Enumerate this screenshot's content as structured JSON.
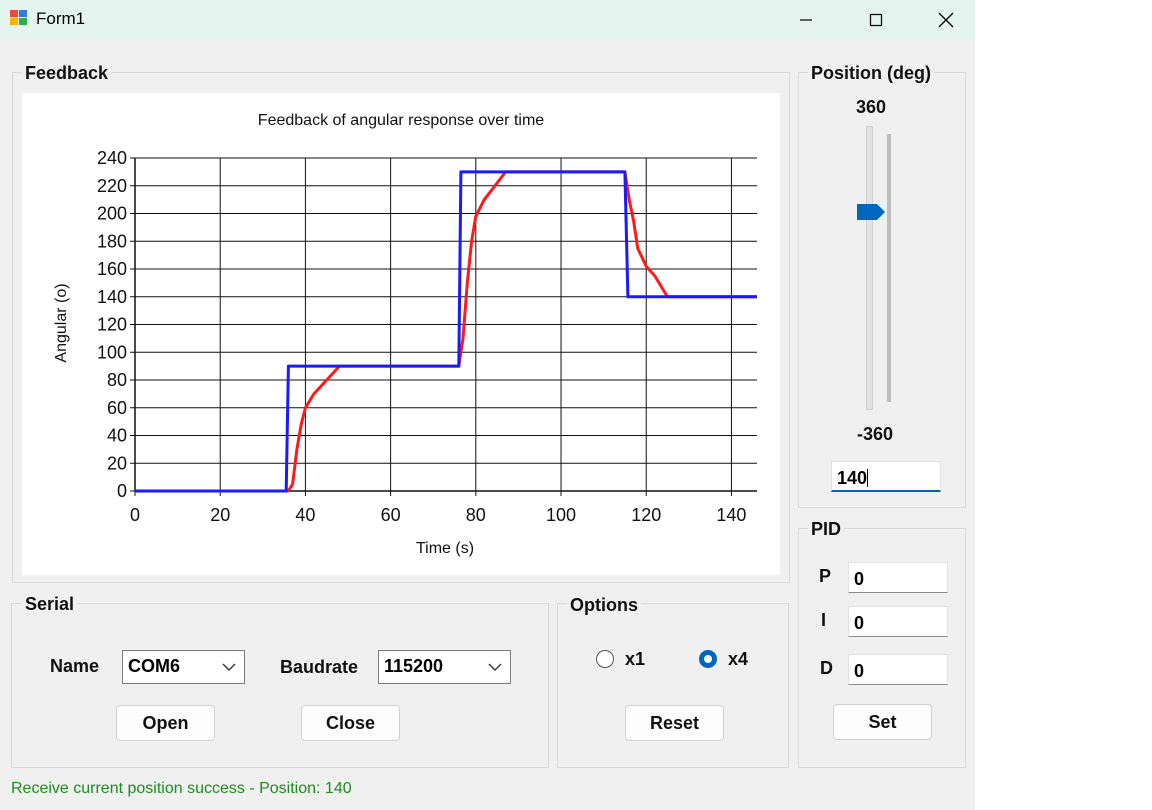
{
  "window": {
    "title": "Form1"
  },
  "feedback": {
    "title": "Feedback"
  },
  "chart_data": {
    "type": "line",
    "title": "Feedback of angular response over time",
    "xlabel": "Time (s)",
    "ylabel": "Angular (o)",
    "xlim": [
      0,
      146
    ],
    "ylim": [
      0,
      240
    ],
    "xticks": [
      0,
      20,
      40,
      60,
      80,
      100,
      120,
      140
    ],
    "yticks": [
      0,
      20,
      40,
      60,
      80,
      100,
      120,
      140,
      160,
      180,
      200,
      220,
      240
    ],
    "grid": true,
    "series": [
      {
        "color": "#1a1aff",
        "x": [
          0,
          35.5,
          36,
          76,
          76.5,
          115,
          115.7,
          146
        ],
        "y": [
          0,
          0,
          90,
          90,
          230,
          230,
          140,
          140
        ]
      },
      {
        "color": "#ff1a1a",
        "x": [
          0,
          36,
          37,
          38,
          39,
          40,
          42,
          45,
          48,
          76,
          77,
          78,
          79,
          80,
          82,
          84,
          87,
          115,
          116,
          117,
          118,
          120,
          122,
          125,
          146
        ],
        "y": [
          0,
          0,
          5,
          30,
          48,
          60,
          70,
          80,
          90,
          90,
          110,
          150,
          180,
          198,
          210,
          218,
          230,
          230,
          210,
          195,
          175,
          162,
          155,
          140,
          140
        ]
      }
    ]
  },
  "position": {
    "title": "Position (deg)",
    "max_label": "360",
    "min_label": "-360",
    "value": "140",
    "slider_value": 140,
    "slider_min": -360,
    "slider_max": 360
  },
  "pid": {
    "title": "PID",
    "p_label": "P",
    "i_label": "I",
    "d_label": "D",
    "p_value": "0",
    "i_value": "0",
    "d_value": "0",
    "set_label": "Set"
  },
  "serial": {
    "title": "Serial",
    "name_label": "Name",
    "name_value": "COM6",
    "baud_label": "Baudrate",
    "baud_value": "115200",
    "open_label": "Open",
    "close_label": "Close"
  },
  "options": {
    "title": "Options",
    "x1_label": "x1",
    "x4_label": "x4",
    "selected": "x4",
    "reset_label": "Reset"
  },
  "status": {
    "text": "Receive current position success - Position: 140"
  },
  "colors": {
    "accent": "#0067c0",
    "status": "#1f8a1f"
  }
}
